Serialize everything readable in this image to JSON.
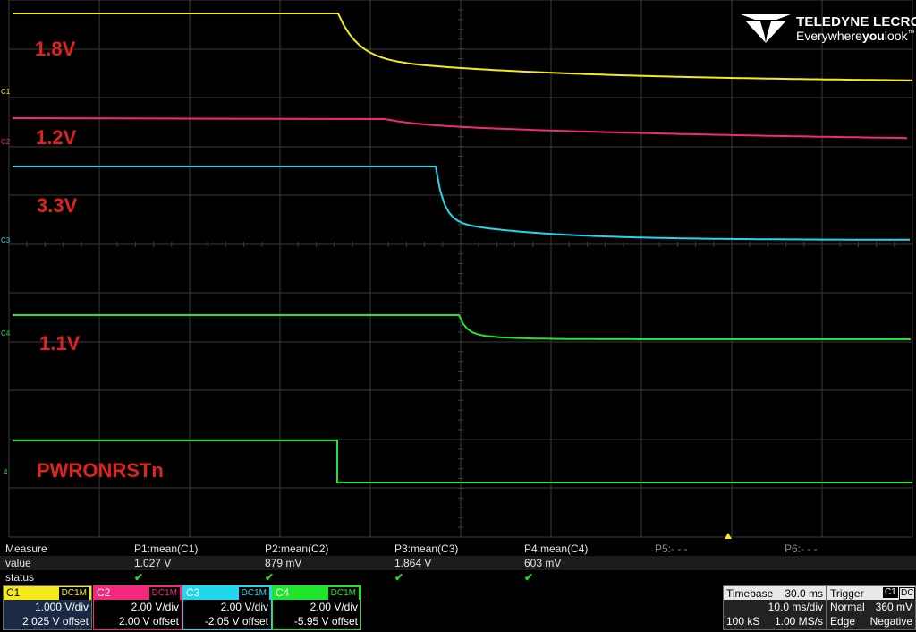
{
  "logo": {
    "line1": "TELEDYNE LECROY",
    "line2_pre": "Everywhere",
    "line2_bold": "you",
    "line2_post": "look",
    "tm": "™",
    "icon": "teledyne-mark-icon"
  },
  "trace_labels": [
    "1.8V",
    "1.2V",
    "3.3V",
    "1.1V",
    "PWRONRSTn"
  ],
  "channel_markers": [
    "C1",
    "C2",
    "C3",
    "C4",
    "4"
  ],
  "colors": {
    "c1": "#f7ea1a",
    "c2": "#f2297f",
    "c3": "#22d6ee",
    "c4": "#21e52a",
    "label": "#e0231f",
    "grid": "#3c3c3c"
  },
  "measure": {
    "headers": [
      "Measure",
      "P1:mean(C1)",
      "P2:mean(C2)",
      "P3:mean(C3)",
      "P4:mean(C4)",
      "P5:- - -",
      "P6:- - -"
    ],
    "value_label": "value",
    "values": [
      "1.027 V",
      "879 mV",
      "1.864 V",
      "603 mV"
    ],
    "status_label": "status",
    "status_mark": "✔"
  },
  "channels": [
    {
      "name": "C1",
      "coupling": "DC1M",
      "vdiv": "1.000 V/div",
      "offset": "2.025 V offset"
    },
    {
      "name": "C2",
      "coupling": "DC1M",
      "vdiv": "2.00 V/div",
      "offset": "2.00 V offset"
    },
    {
      "name": "C3",
      "coupling": "DC1M",
      "vdiv": "2.00 V/div",
      "offset": "-2.05 V offset"
    },
    {
      "name": "C4",
      "coupling": "DC1M",
      "vdiv": "2.00 V/div",
      "offset": "-5.95 V offset"
    }
  ],
  "timebase": {
    "label": "Timebase",
    "delay": "30.0 ms",
    "tdiv": "10.0 ms/div",
    "samples": "100 kS",
    "rate": "1.00 MS/s"
  },
  "trigger": {
    "label": "Trigger",
    "source": "C1",
    "coupling": "DC",
    "mode": "Normal",
    "level": "360 mV",
    "type": "Edge",
    "slope": "Negative"
  }
}
